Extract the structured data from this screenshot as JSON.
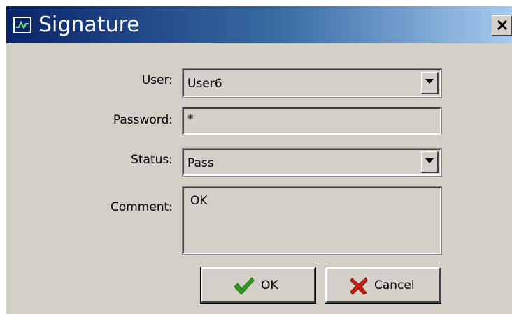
{
  "window": {
    "title": "Signature",
    "title_icon": "waveform-icon",
    "close_icon": "close-icon",
    "colors": {
      "titlebar_start": "#0a246a",
      "titlebar_end": "#a6caf0",
      "face": "#d4d0c8"
    }
  },
  "form": {
    "user": {
      "label": "User:",
      "value": "User6"
    },
    "password": {
      "label": "Password:",
      "value": "*"
    },
    "status": {
      "label": "Status:",
      "value": "Pass"
    },
    "comment": {
      "label": "Comment:",
      "value": "OK"
    }
  },
  "buttons": {
    "ok": {
      "label": "OK",
      "icon": "checkmark-icon",
      "icon_color": "#2e9a1a"
    },
    "cancel": {
      "label": "Cancel",
      "icon": "red-x-icon",
      "icon_color": "#c81e14"
    }
  }
}
